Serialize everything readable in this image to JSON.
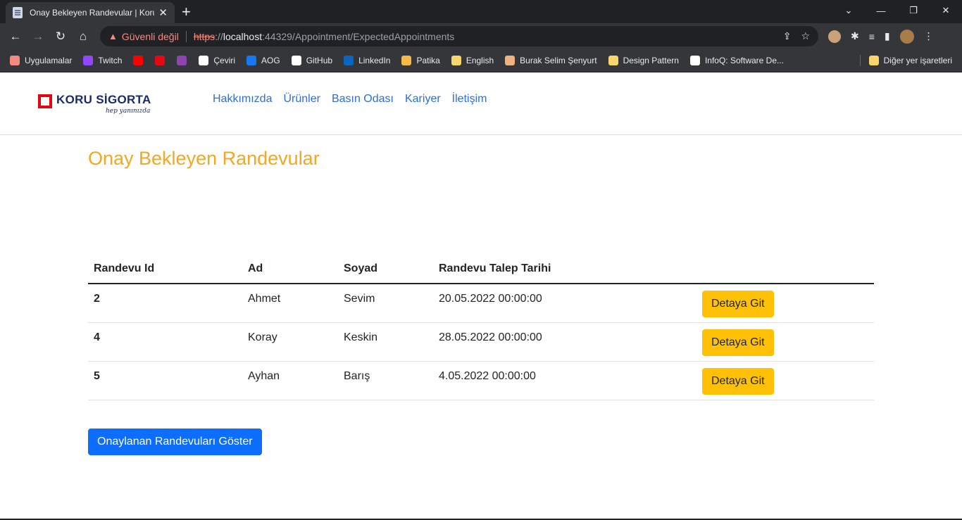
{
  "browser": {
    "tab_title": "Onay Bekleyen Randevular | Koru",
    "security_label": "Güvenli değil",
    "url_scheme": "https",
    "url_sep": "://",
    "url_host": "localhost",
    "url_rest": ":44329/Appointment/ExpectedAppointments",
    "bookmarks": [
      {
        "label": "Uygulamalar",
        "icon": "apps-grid-icon",
        "color": "#f28b82"
      },
      {
        "label": "Twitch",
        "icon": "twitch-icon",
        "color": "#9146ff"
      },
      {
        "label": "",
        "icon": "youtube-icon",
        "color": "#ff0000"
      },
      {
        "label": "",
        "icon": "netflix-icon",
        "color": "#e50914"
      },
      {
        "label": "",
        "icon": "u-extension-icon",
        "color": "#8e44ad"
      },
      {
        "label": "Çeviri",
        "icon": "google-icon",
        "color": "#ffffff"
      },
      {
        "label": "AOG",
        "icon": "facebook-icon",
        "color": "#1877f2"
      },
      {
        "label": "GitHub",
        "icon": "github-icon",
        "color": "#ffffff"
      },
      {
        "label": "LinkedIn",
        "icon": "linkedin-icon",
        "color": "#0a66c2"
      },
      {
        "label": "Patika",
        "icon": "patika-icon",
        "color": "#f5b94a"
      },
      {
        "label": "English",
        "icon": "folder-icon",
        "color": "#f9d66b"
      },
      {
        "label": "Burak Selim Şenyurt",
        "icon": "pen-icon",
        "color": "#f0b37e"
      },
      {
        "label": "Design Pattern",
        "icon": "folder-icon",
        "color": "#f9d66b"
      },
      {
        "label": "InfoQ: Software De...",
        "icon": "infoq-icon",
        "color": "#ffffff"
      }
    ],
    "other_bookmarks": "Diğer yer işaretleri"
  },
  "site": {
    "brand": "KORU SİGORTA",
    "tagline": "hep yanınızda",
    "nav": [
      "Hakkımızda",
      "Ürünler",
      "Basın Odası",
      "Kariyer",
      "İletişim"
    ]
  },
  "page": {
    "title": "Onay Bekleyen Randevular",
    "table": {
      "headers": [
        "Randevu Id",
        "Ad",
        "Soyad",
        "Randevu Talep Tarihi",
        ""
      ],
      "rows": [
        {
          "id": "2",
          "first_name": "Ahmet",
          "last_name": "Sevim",
          "date": "20.05.2022 00:00:00",
          "action": "Detaya Git"
        },
        {
          "id": "4",
          "first_name": "Koray",
          "last_name": "Keskin",
          "date": "28.05.2022 00:00:00",
          "action": "Detaya Git"
        },
        {
          "id": "5",
          "first_name": "Ayhan",
          "last_name": "Barış",
          "date": "4.05.2022 00:00:00",
          "action": "Detaya Git"
        }
      ]
    },
    "show_approved_button": "Onaylanan Randevuları Göster"
  },
  "colors": {
    "title": "#f5a623",
    "nav_link": "#2f6ddb",
    "detail_button": "#ffc107",
    "primary_button": "#0d6efd",
    "brand_red": "#e30613",
    "brand_navy": "#1b2a6b"
  }
}
